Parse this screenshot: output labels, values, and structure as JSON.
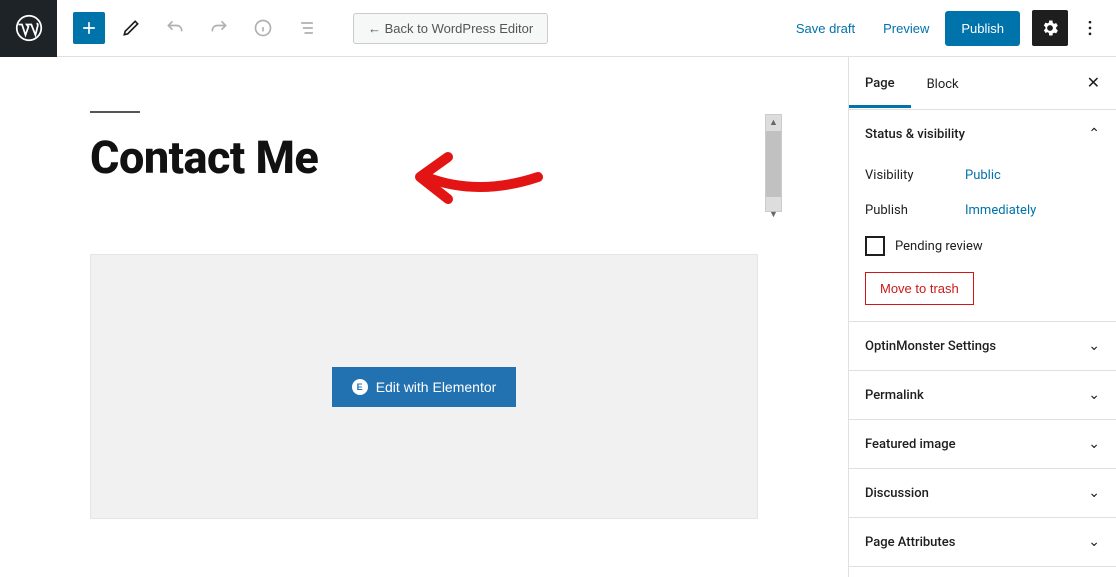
{
  "toolbar": {
    "back_label": "← Back to WordPress Editor",
    "save_draft": "Save draft",
    "preview": "Preview",
    "publish": "Publish"
  },
  "editor": {
    "page_title": "Contact Me",
    "elementor_button": "Edit with Elementor"
  },
  "sidebar": {
    "tabs": {
      "page": "Page",
      "block": "Block"
    },
    "panels": {
      "status": {
        "title": "Status & visibility",
        "visibility_label": "Visibility",
        "visibility_value": "Public",
        "publish_label": "Publish",
        "publish_value": "Immediately",
        "pending_review": "Pending review",
        "trash": "Move to trash"
      },
      "optin": "OptinMonster Settings",
      "permalink": "Permalink",
      "featured": "Featured image",
      "discussion": "Discussion",
      "attributes": "Page Attributes"
    }
  }
}
